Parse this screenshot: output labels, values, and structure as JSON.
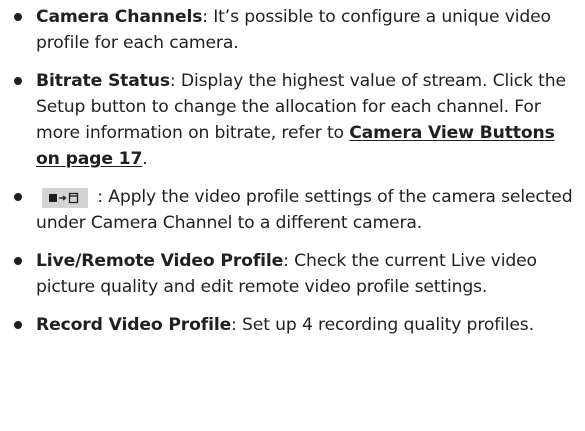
{
  "items": [
    {
      "term": "Camera Channels",
      "text": ": It’s possible to configure a unique video profile for each camera."
    },
    {
      "term": "Bitrate Status",
      "text": ": Display the highest value of stream. Click the Setup button to change the allocation for each channel. For more information on bitrate, refer to ",
      "link": "Camera View Buttons on page 17",
      "after": "."
    },
    {
      "icon": "copy-profile-icon",
      "text": " : Apply the video profile settings of the camera selected under Camera Channel to a different camera."
    },
    {
      "term": "Live/Remote Video Profile",
      "text": ": Check the current Live video picture quality and edit remote video profile settings."
    },
    {
      "term": "Record Video Profile",
      "text": ": Set up 4 recording quality profiles."
    }
  ],
  "colors": {
    "text": "#231f20",
    "button_bg": "#d4d4d4"
  }
}
